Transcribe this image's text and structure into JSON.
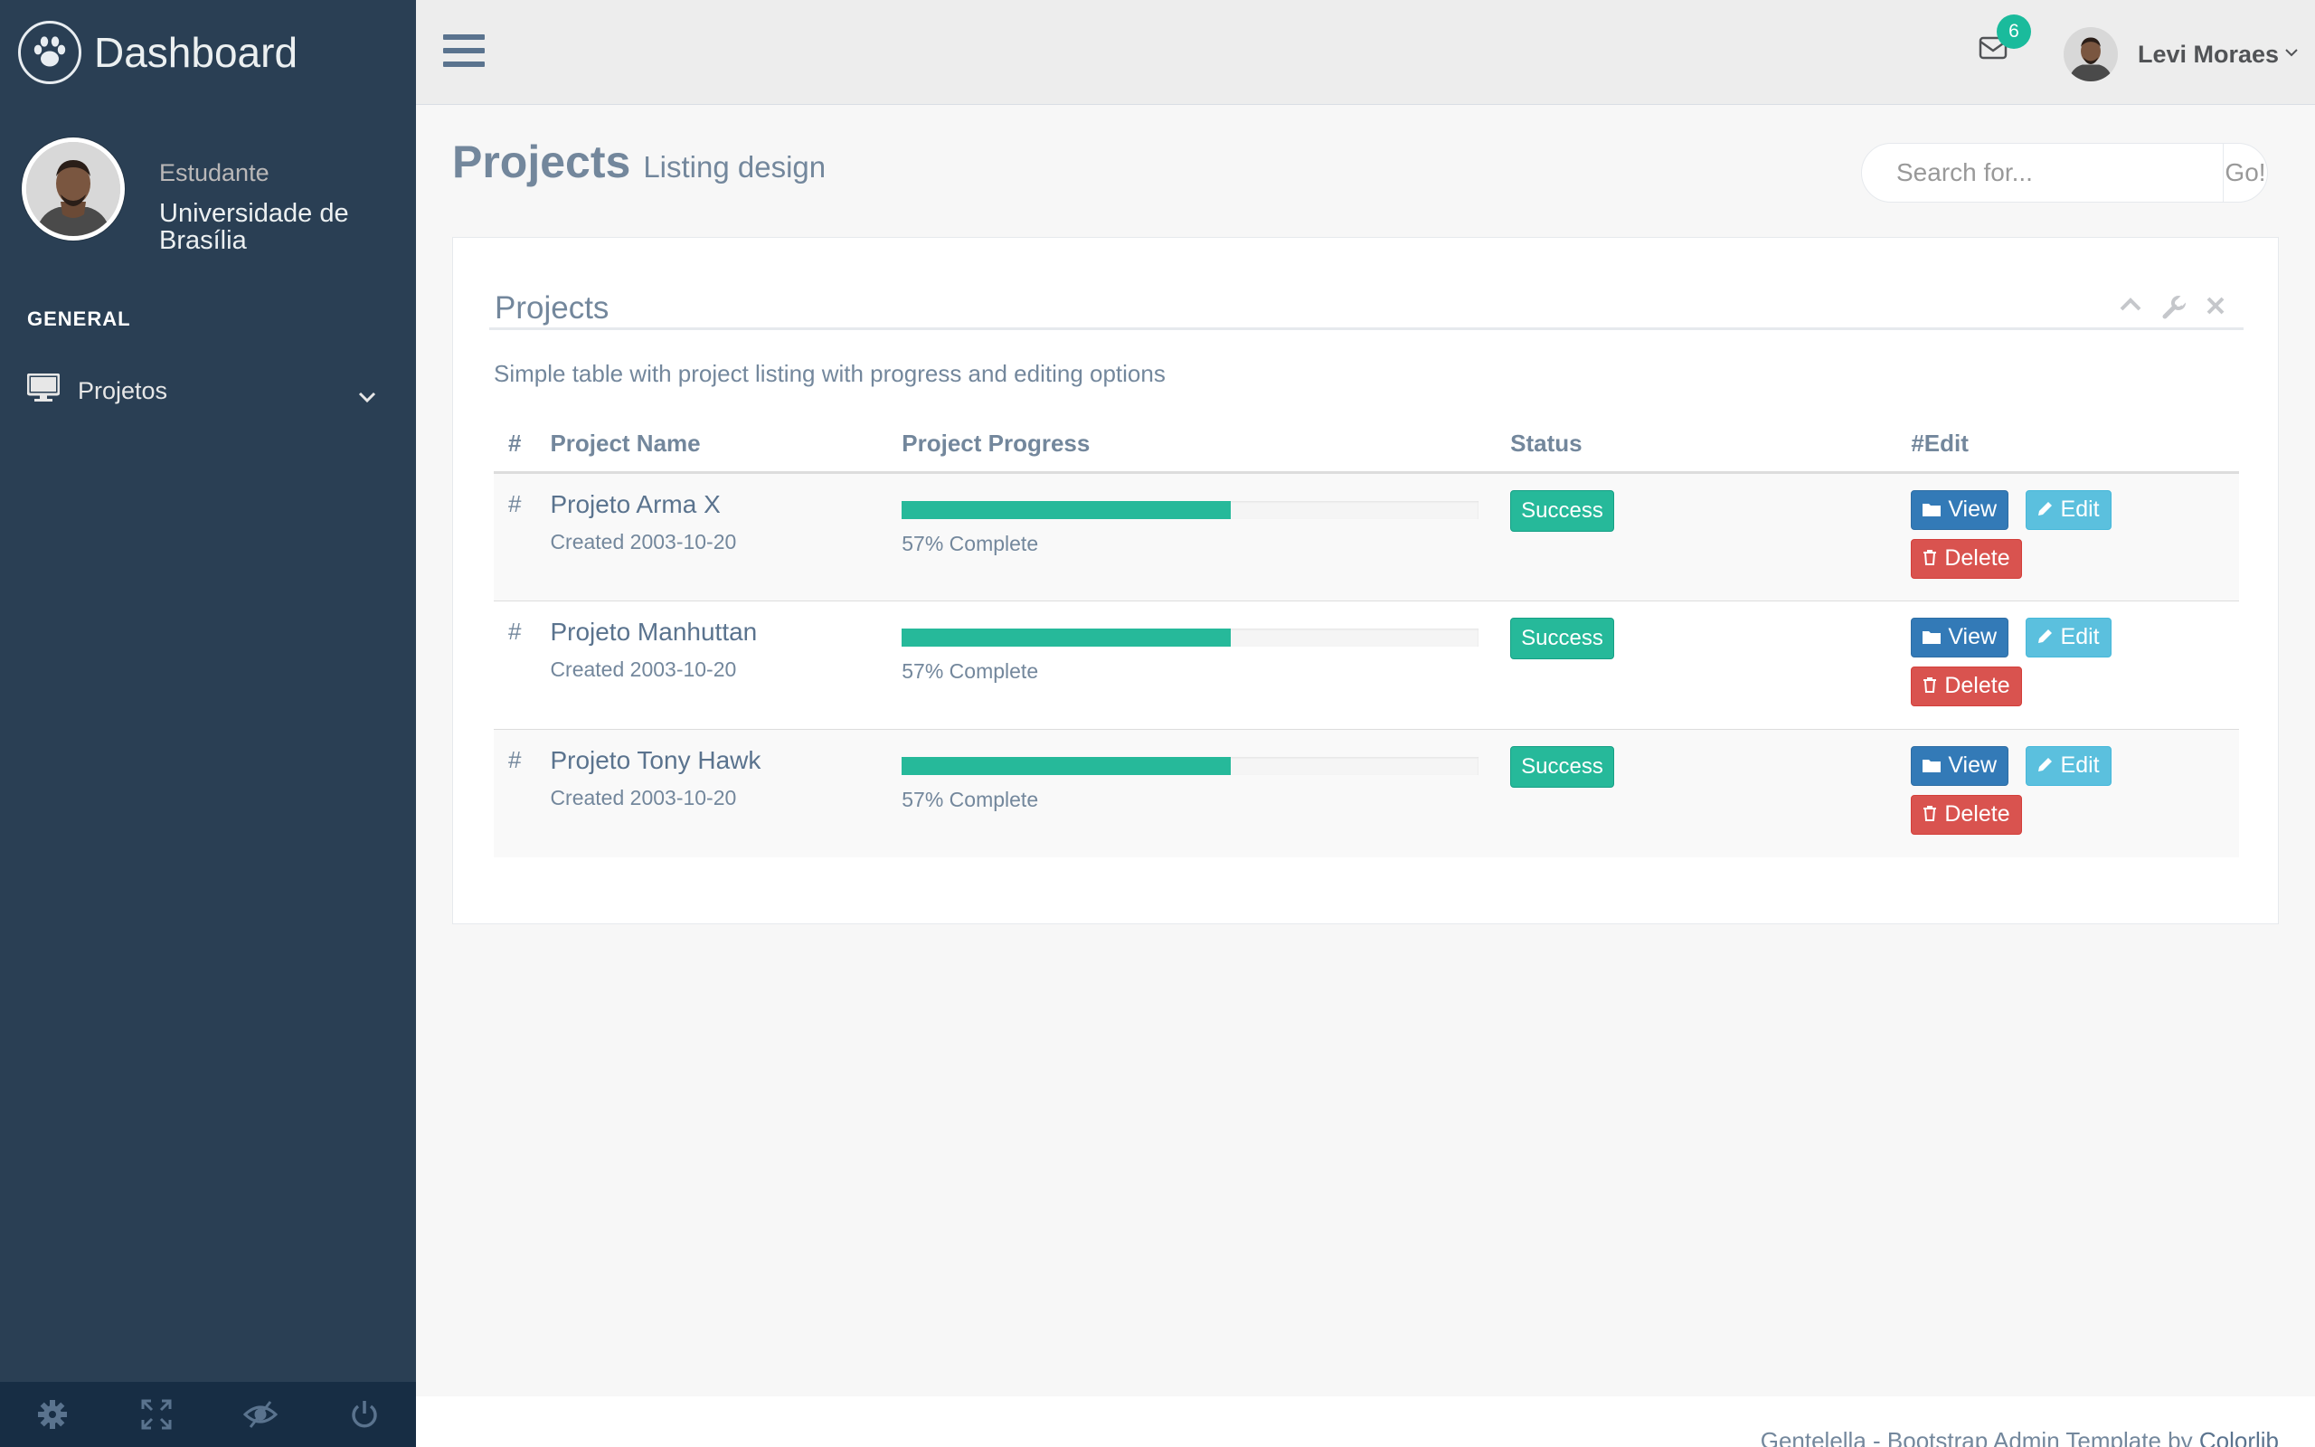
{
  "brand": {
    "title": "Dashboard",
    "logo_icon": "paw-icon"
  },
  "profile": {
    "role": "Estudante",
    "name": "Universidade de Brasília"
  },
  "sidebar": {
    "section_title": "GENERAL",
    "items": [
      {
        "label": "Projetos",
        "icon": "desktop-icon",
        "expanded": false
      }
    ],
    "footer_icons": [
      "settings-icon",
      "fullscreen-icon",
      "lock-icon",
      "logout-icon"
    ]
  },
  "topnav": {
    "mail_count": "6",
    "user_name": "Levi Moraes"
  },
  "page": {
    "title": "Projects",
    "subtitle": "Listing design"
  },
  "search": {
    "placeholder": "Search for...",
    "button_label": "Go!"
  },
  "panel": {
    "title": "Projects",
    "description": "Simple table with project listing with progress and editing options"
  },
  "table": {
    "headers": {
      "hash": "#",
      "name": "Project Name",
      "progress": "Project Progress",
      "status": "Status",
      "edit": "#Edit"
    },
    "rows": [
      {
        "hash": "#",
        "name": "Projeto Arma X",
        "created": "Created 2003-10-20",
        "progress": 57,
        "progress_text": "57% Complete",
        "status": "Success",
        "view": "View",
        "edit": "Edit",
        "delete": "Delete"
      },
      {
        "hash": "#",
        "name": "Projeto Manhuttan",
        "created": "Created 2003-10-20",
        "progress": 57,
        "progress_text": "57% Complete",
        "status": "Success",
        "view": "View",
        "edit": "Edit",
        "delete": "Delete"
      },
      {
        "hash": "#",
        "name": "Projeto Tony Hawk",
        "created": "Created 2003-10-20",
        "progress": 57,
        "progress_text": "57% Complete",
        "status": "Success",
        "view": "View",
        "edit": "Edit",
        "delete": "Delete"
      }
    ]
  },
  "footer": {
    "text": "Gentelella - Bootstrap Admin Template by",
    "link": "Colorlib"
  },
  "colors": {
    "sidebar_bg": "#2A3F54",
    "accent_green": "#26B99A",
    "primary": "#337AB7",
    "info": "#5BC0DE",
    "danger": "#D9534F"
  }
}
